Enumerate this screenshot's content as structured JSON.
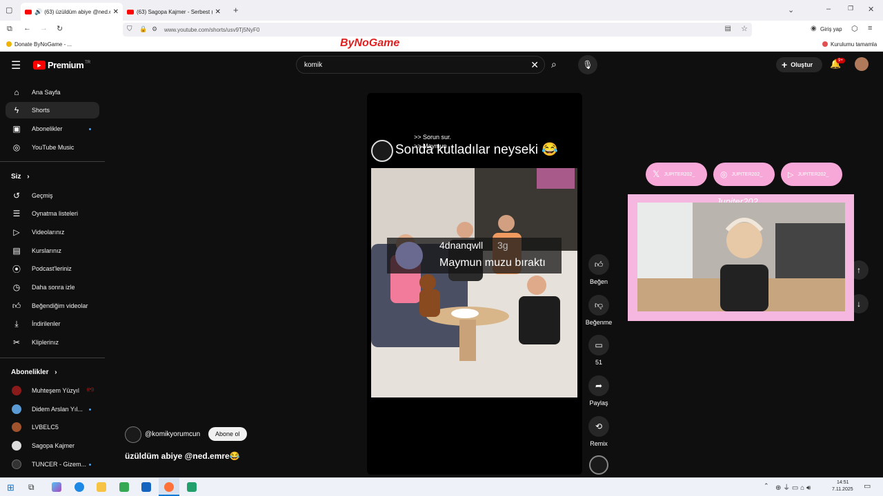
{
  "browser": {
    "tabs": [
      {
        "title": "(63) üzüldüm abiye @ned.e"
      },
      {
        "title": "(63) Sagopa Kajmer - Serbest (C"
      }
    ],
    "url": "www.youtube.com/shorts/usv9Tj5NyF0",
    "login_label": "Giriş yap",
    "bookmark": "Donate ByNoGame - ...",
    "bookmark_right": "Kurulumu tamamla",
    "overlay_brand": "ByNoGame"
  },
  "header": {
    "logo_text": "Premium",
    "logo_badge": "TR",
    "search_value": "komik",
    "create_label": "Oluştur",
    "notif_count": "9+"
  },
  "sidebar": {
    "main": [
      {
        "label": "Ana Sayfa",
        "icon": "home-icon"
      },
      {
        "label": "Shorts",
        "icon": "shorts-icon"
      },
      {
        "label": "Abonelikler",
        "icon": "subscriptions-icon"
      },
      {
        "label": "YouTube Music",
        "icon": "music-icon"
      }
    ],
    "you_title": "Siz",
    "you": [
      {
        "label": "Geçmiş"
      },
      {
        "label": "Oynatma listeleri"
      },
      {
        "label": "Videolarınız"
      },
      {
        "label": "Kurslarınız"
      },
      {
        "label": "Podcast'leriniz"
      },
      {
        "label": "Daha sonra izle"
      },
      {
        "label": "Beğendiğim videolar"
      },
      {
        "label": "İndirilenler"
      },
      {
        "label": "Kliplerinız"
      }
    ],
    "subs_title": "Abonelikler",
    "subs": [
      {
        "label": "Muhteşem Yüzyıl",
        "color": "#8b1a1a"
      },
      {
        "label": "Didem Arslan Yıl...",
        "color": "#5a9bd5"
      },
      {
        "label": "LVBELC5",
        "color": "#a0522d"
      },
      {
        "label": "Sagopa Kajmer",
        "color": "#dddddd"
      },
      {
        "label": "TUNCER - Gizem...",
        "color": "#333333"
      }
    ]
  },
  "short": {
    "caption_title": "Sonda kutladılar neyseki 😂",
    "overlay_top1": ">> Sorun sur.",
    "overlay_top2": ">> Maymun",
    "comment_user": "4dnanqwll",
    "comment_time": "3g",
    "comment_text": "Maymun muzu bıraktı",
    "channel": "@komikyorumcun",
    "subscribe": "Abone ol",
    "title": "üzüldüm abiye @ned.emre😂",
    "actions": {
      "like": "Beğen",
      "dislike": "Beğenme",
      "comments": "51",
      "share": "Paylaş",
      "remix": "Remix"
    }
  },
  "stream": {
    "social": [
      "JUPITER202_",
      "JUPITER202_",
      "JUPITER202_"
    ],
    "name": "Jupiter202_"
  },
  "taskbar": {
    "time": "14:51",
    "date": "7.11.2025"
  },
  "colors": {
    "bg": "#0f0f0f",
    "accent_red": "#ff0000",
    "pink": "#f7a8d8"
  }
}
